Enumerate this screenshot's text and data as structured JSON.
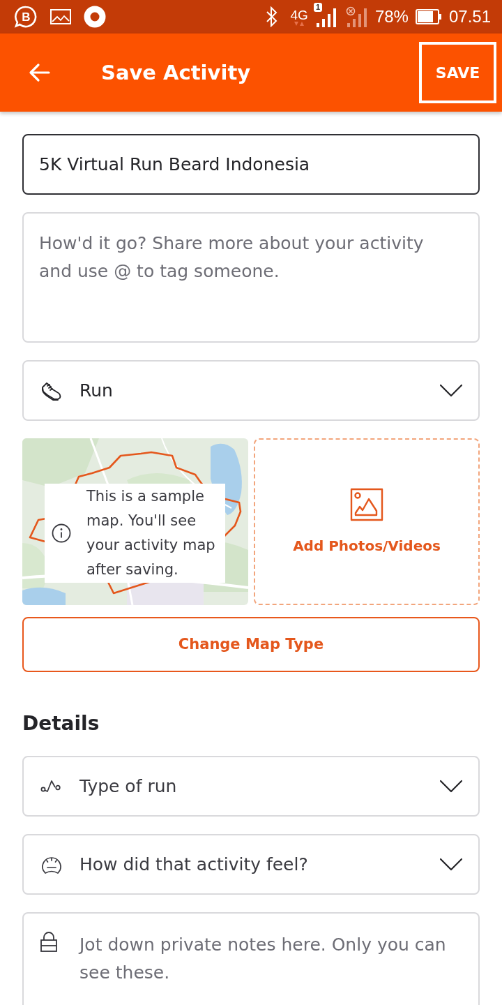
{
  "status_bar": {
    "app_letter": "B",
    "network": "4G",
    "sim_badge": "1",
    "battery": "78%",
    "time": "07.51"
  },
  "app_bar": {
    "title": "Save Activity",
    "action": "SAVE"
  },
  "title_field": {
    "value": "5K Virtual Run Beard Indonesia",
    "focused": true
  },
  "description_field": {
    "placeholder": "How'd it go? Share more about your activity and use @ to tag someone."
  },
  "sport_select": {
    "value": "Run"
  },
  "map_preview": {
    "notice": "This is a sample map. You'll see your activity map after saving."
  },
  "media_button": {
    "label": "Add Photos/Videos"
  },
  "change_map_button": {
    "label": "Change Map Type"
  },
  "details": {
    "heading": "Details",
    "selects": [
      {
        "label": "Type of run"
      },
      {
        "label": "How did that activity feel?"
      }
    ],
    "notes_field": {
      "placeholder": "Jot down private notes here. Only you can see these."
    }
  }
}
